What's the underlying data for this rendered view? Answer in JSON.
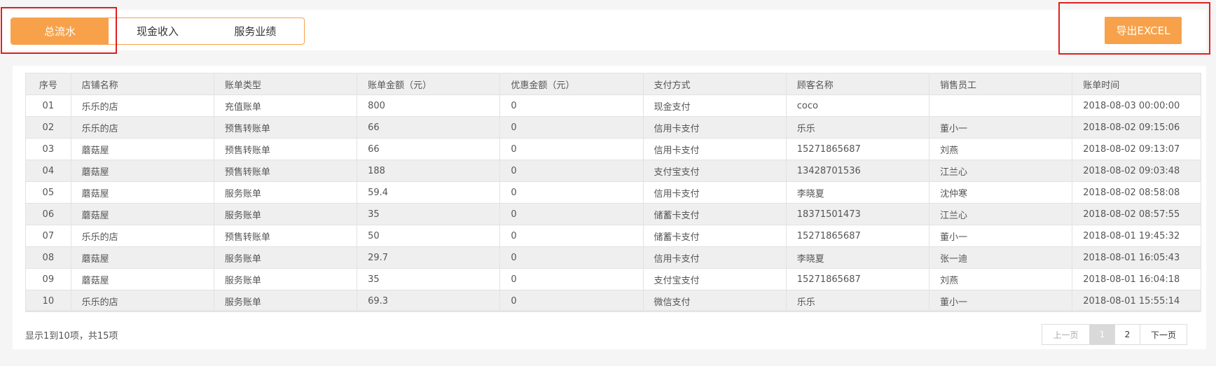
{
  "tabs": [
    {
      "label": "总流水"
    },
    {
      "label": "现金收入"
    },
    {
      "label": "服务业绩"
    }
  ],
  "export_label": "导出EXCEL",
  "table": {
    "headers": [
      "序号",
      "店铺名称",
      "账单类型",
      "账单金额（元）",
      "优惠金额（元）",
      "支付方式",
      "顾客名称",
      "销售员工",
      "账单时间"
    ],
    "rows": [
      [
        "01",
        "乐乐的店",
        "充值账单",
        "800",
        "0",
        "现金支付",
        "coco",
        "",
        "2018-08-03 00:00:00"
      ],
      [
        "02",
        "乐乐的店",
        "预售转账单",
        "66",
        "0",
        "信用卡支付",
        "乐乐",
        "董小一",
        "2018-08-02 09:15:06"
      ],
      [
        "03",
        "蘑菇屋",
        "预售转账单",
        "66",
        "0",
        "信用卡支付",
        "15271865687",
        "刘燕",
        "2018-08-02 09:13:07"
      ],
      [
        "04",
        "蘑菇屋",
        "预售转账单",
        "188",
        "0",
        "支付宝支付",
        "13428701536",
        "江兰心",
        "2018-08-02 09:03:48"
      ],
      [
        "05",
        "蘑菇屋",
        "服务账单",
        "59.4",
        "0",
        "信用卡支付",
        "李晓夏",
        "沈仲寒",
        "2018-08-02 08:58:08"
      ],
      [
        "06",
        "蘑菇屋",
        "服务账单",
        "35",
        "0",
        "储蓄卡支付",
        "18371501473",
        "江兰心",
        "2018-08-02 08:57:55"
      ],
      [
        "07",
        "乐乐的店",
        "预售转账单",
        "50",
        "0",
        "储蓄卡支付",
        "15271865687",
        "董小一",
        "2018-08-01 19:45:32"
      ],
      [
        "08",
        "蘑菇屋",
        "服务账单",
        "29.7",
        "0",
        "信用卡支付",
        "李晓夏",
        "张一迪",
        "2018-08-01 16:05:43"
      ],
      [
        "09",
        "蘑菇屋",
        "服务账单",
        "35",
        "0",
        "支付宝支付",
        "15271865687",
        "刘燕",
        "2018-08-01 16:04:18"
      ],
      [
        "10",
        "乐乐的店",
        "服务账单",
        "69.3",
        "0",
        "微信支付",
        "乐乐",
        "董小一",
        "2018-08-01 15:55:14"
      ]
    ]
  },
  "summary": "显示1到10项，共15项",
  "pagination": {
    "prev": "上一页",
    "pages": [
      "1",
      "2"
    ],
    "next": "下一页"
  },
  "colors": {
    "accent": "#f7a24b",
    "highlight_box": "#e02020"
  }
}
